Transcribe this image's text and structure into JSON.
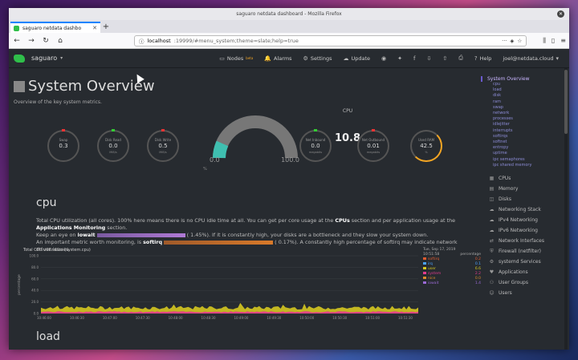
{
  "window": {
    "title": "saguaro netdata dashboard - Mozilla Firefox"
  },
  "tab": {
    "title": "saguaro netdata dashbo"
  },
  "url": {
    "host": "localhost",
    "path": ":19999/#menu_system;theme=slate;help=true"
  },
  "netdata": {
    "host": "saguaro",
    "nav": {
      "nodes": "Nodes",
      "beta": "beta",
      "alarms": "Alarms",
      "settings": "Settings",
      "update": "Update",
      "help": "Help",
      "account": "joel@netdata.cloud"
    }
  },
  "page": {
    "title": "System Overview",
    "subtitle": "Overview of the key system metrics."
  },
  "gauges": [
    {
      "title": "Swap",
      "value": "0.3",
      "unit": "",
      "color": "#e33"
    },
    {
      "title": "Disk Read",
      "value": "0.0",
      "unit": "MiB/s",
      "color": "#3c3"
    },
    {
      "title": "Disk Write",
      "value": "0.5",
      "unit": "MiB/s",
      "color": "#e33"
    },
    {
      "title": "Net Inbound",
      "value": "0.0",
      "unit": "megabits",
      "color": "#3c3"
    },
    {
      "title": "Net Outbound",
      "value": "0.01",
      "unit": "megabits",
      "color": "#e33"
    },
    {
      "title": "Used RAM",
      "value": "42.5",
      "unit": "%",
      "color": "#f5a623"
    }
  ],
  "cpu_gauge": {
    "title": "CPU",
    "value": "10.8",
    "min": "0.0",
    "max": "100.0",
    "unit": "%"
  },
  "cpu_section": {
    "title": "cpu",
    "desc1": "Total CPU utilization (all cores). 100% here means there is no CPU idle time at all. You can get per core usage at the",
    "desc1_cpus": "CPUs",
    "desc1b": "section and per application usage at the",
    "desc1_apps": "Applications Monitoring",
    "desc1c": "section.",
    "desc2a": "Keep an eye on",
    "desc2_iowait": "iowait",
    "desc2b": "( 1.45%). If it is constantly high, your disks are a bottleneck and they slow your system down.",
    "desc3a": "An important metric worth monitoring, is",
    "desc3_softirq": "softirq",
    "desc3b": "( 0.17%). A constantly high percentage of softirq may indicate network driver issues."
  },
  "chart": {
    "title": "Total CPU utilization (system.cpu)",
    "date": "Tue, Sep 17, 2019",
    "time": "10:51:58",
    "unit_label": "percentage"
  },
  "chart_data": {
    "type": "area",
    "title": "Total CPU utilization (system.cpu)",
    "ylabel": "percentage",
    "ylim": [
      0,
      100
    ],
    "yticks": [
      "100.0",
      "80.0",
      "60.0",
      "40.0",
      "20.0",
      "0.0"
    ],
    "xticks": [
      "10:46:00",
      "10:46:30",
      "10:47:00",
      "10:47:30",
      "10:48:00",
      "10:48:30",
      "10:49:00",
      "10:49:30",
      "10:50:00",
      "10:50:30",
      "10:51:00",
      "10:51:30"
    ],
    "series": [
      {
        "name": "softirq",
        "value": "0.2",
        "color": "#e05a2f"
      },
      {
        "name": "irq",
        "value": "0.1",
        "color": "#4aa3ff"
      },
      {
        "name": "user",
        "value": "6.6",
        "color": "#d6c820"
      },
      {
        "name": "system",
        "value": "2.2",
        "color": "#e33a8f"
      },
      {
        "name": "nice",
        "value": "0.0",
        "color": "#d98a2a"
      },
      {
        "name": "iowait",
        "value": "1.4",
        "color": "#9b6ad6"
      }
    ]
  },
  "load_section": {
    "title": "load"
  },
  "sidebar": {
    "active": "System Overview",
    "subs": [
      "cpu",
      "load",
      "disk",
      "ram",
      "swap",
      "network",
      "processes",
      "idlejitter",
      "interrupts",
      "softirqs",
      "softnet",
      "entropy",
      "uptime",
      "ipc semaphores",
      "ipc shared memory"
    ],
    "menus": [
      {
        "label": "CPUs",
        "icon": "cpu-icon"
      },
      {
        "label": "Memory",
        "icon": "memory-icon"
      },
      {
        "label": "Disks",
        "icon": "disk-icon"
      },
      {
        "label": "Networking Stack",
        "icon": "cloud-icon"
      },
      {
        "label": "IPv4 Networking",
        "icon": "cloud-icon"
      },
      {
        "label": "IPv6 Networking",
        "icon": "cloud-icon"
      },
      {
        "label": "Network Interfaces",
        "icon": "share-icon"
      },
      {
        "label": "Firewall (netfilter)",
        "icon": "shield-icon"
      },
      {
        "label": "systemd Services",
        "icon": "gears-icon"
      },
      {
        "label": "Applications",
        "icon": "heartbeat-icon"
      },
      {
        "label": "User Groups",
        "icon": "users-icon"
      },
      {
        "label": "Users",
        "icon": "user-icon"
      }
    ]
  }
}
